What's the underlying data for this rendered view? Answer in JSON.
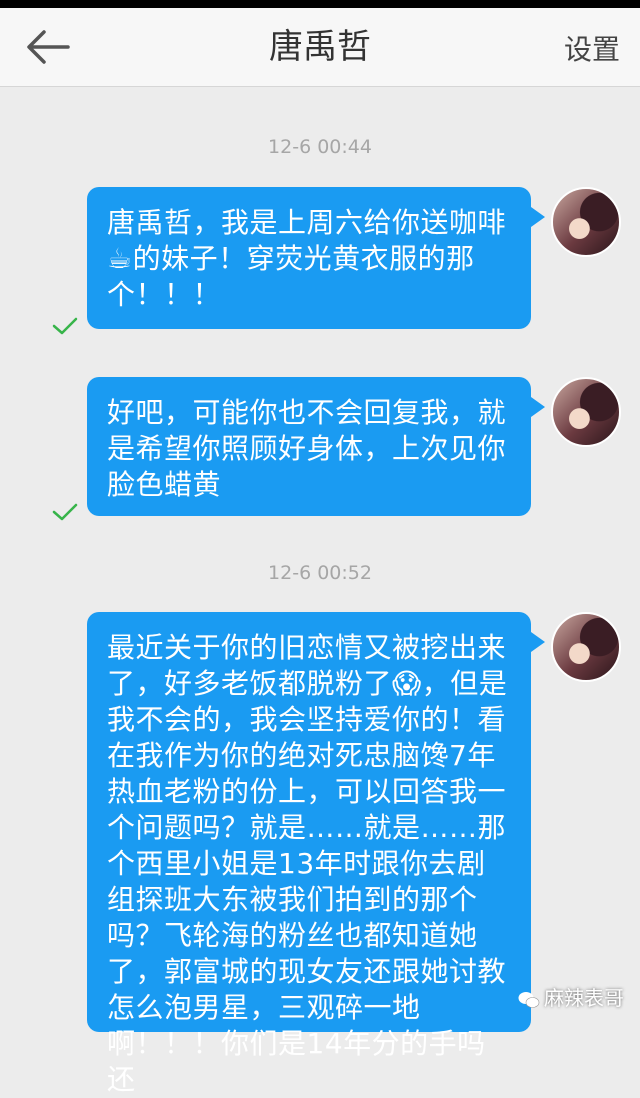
{
  "header": {
    "title": "唐禹哲",
    "settings_label": "设置"
  },
  "messages": [
    {
      "timestamp": "12-6 00:44",
      "text": "唐禹哲，我是上周六给你送咖啡☕的妹子！穿荧光黄衣服的那个！！！",
      "status": "sent"
    },
    {
      "text": "好吧，可能你也不会回复我，就是希望你照顾好身体，上次见你脸色蜡黄",
      "status": "sent"
    },
    {
      "timestamp": "12-6 00:52",
      "text": "最近关于你的旧恋情又被挖出来了，好多老饭都脱粉了😱，但是我不会的，我会坚持爱你的！看在我作为你的绝对死忠脑馋7年热血老粉的份上，可以回答我一个问题吗？就是……就是……那个西里小姐是13年时跟你去剧组探班大东被我们拍到的那个吗？飞轮海的粉丝也都知道她了，郭富城的现女友还跟她讨教怎么泡男星，三观碎一地啊！！！你们是14年分的手吗还"
    }
  ],
  "watermark": "麻辣表哥"
}
